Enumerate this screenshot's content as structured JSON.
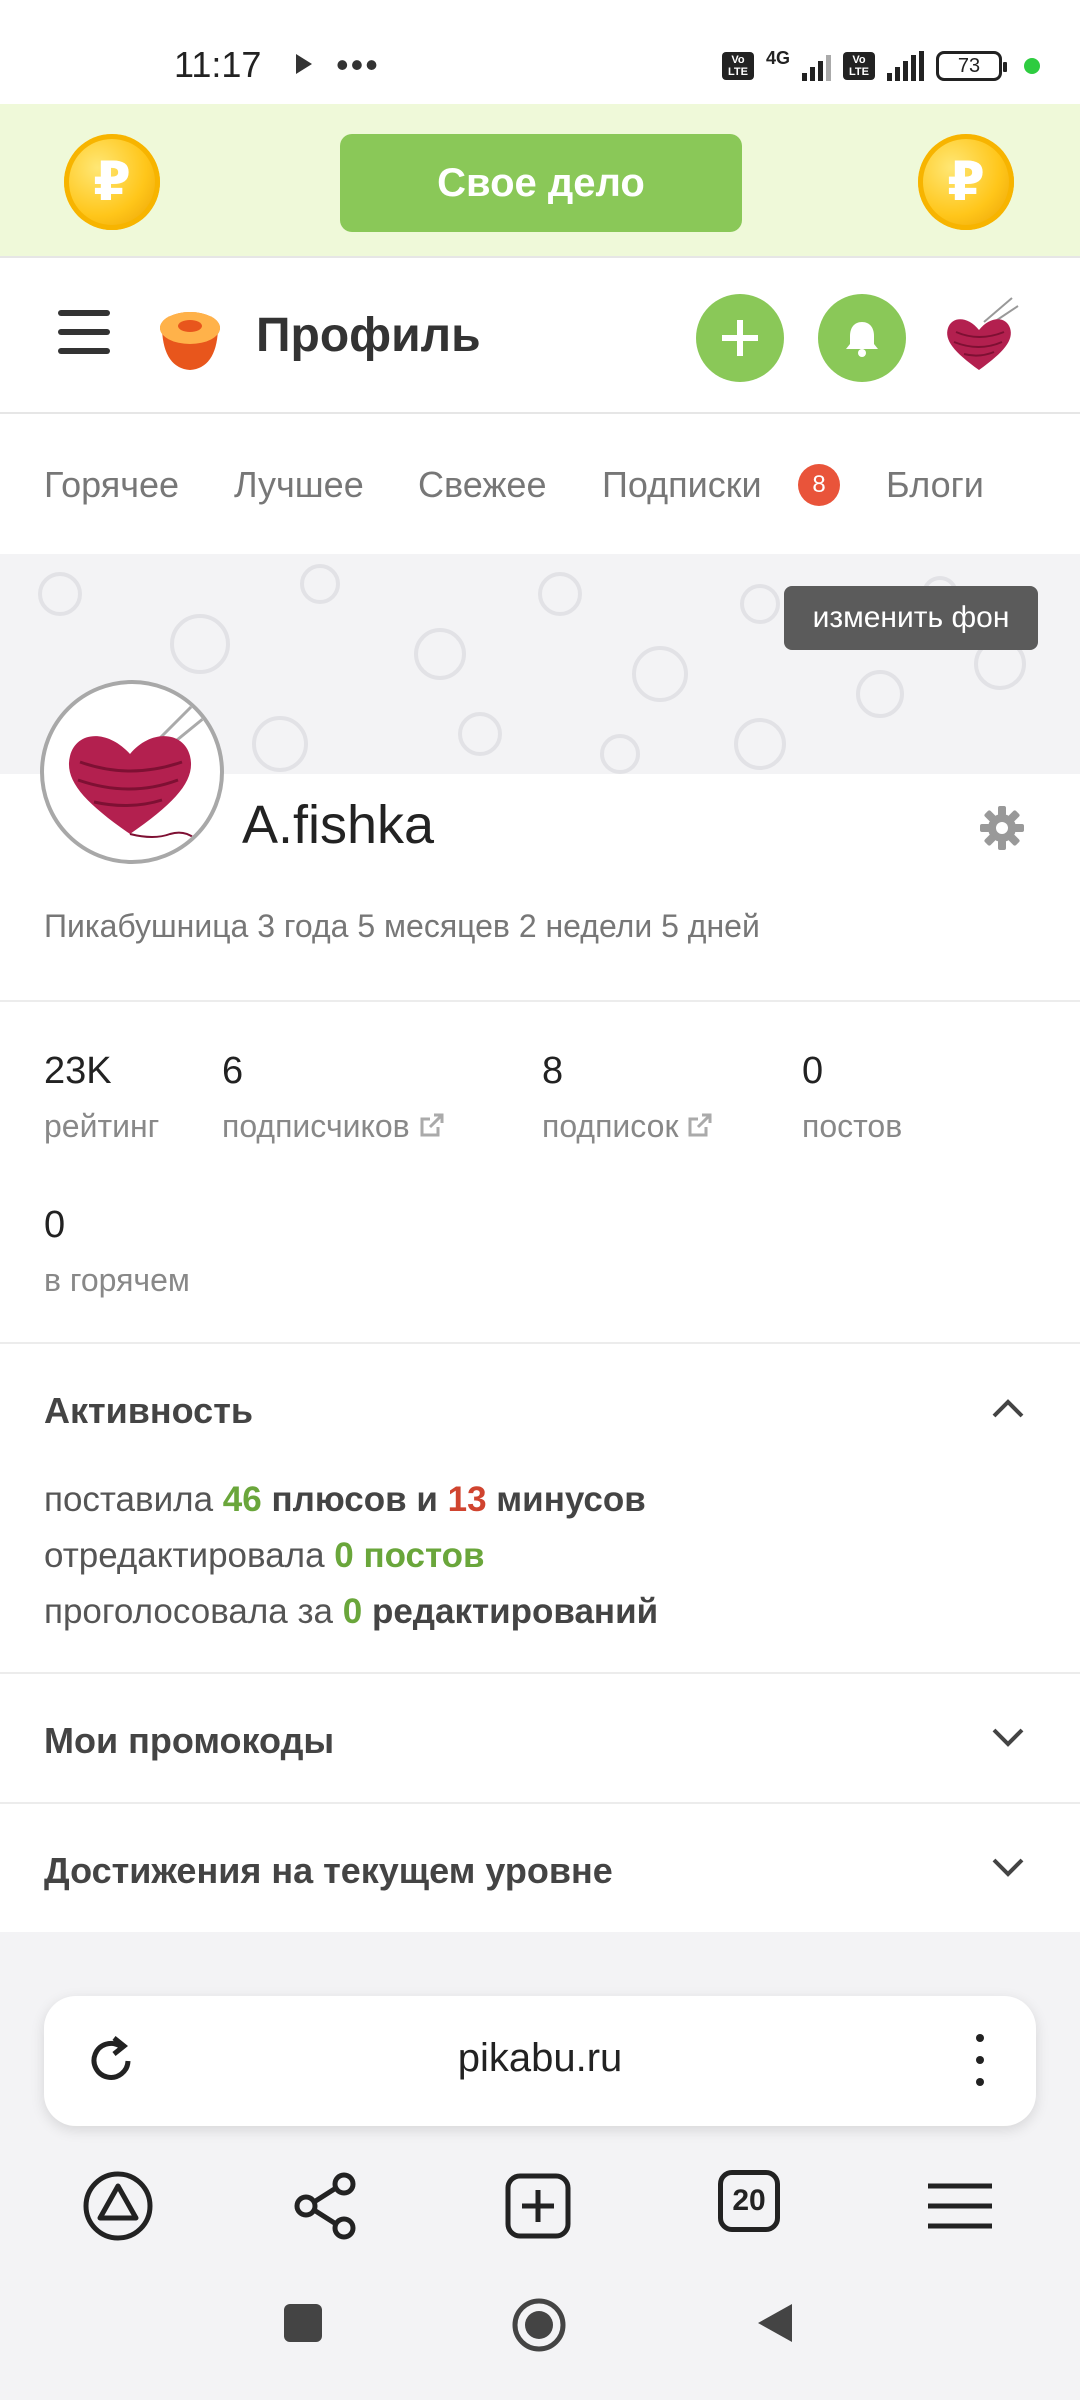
{
  "status_bar": {
    "time": "11:17",
    "dots": "•••",
    "volte": "Vo LTE",
    "network": "4G",
    "battery": "73"
  },
  "promo": {
    "button_label": "Свое дело",
    "coin_symbol": "₽"
  },
  "header": {
    "title": "Профиль",
    "add_icon": "plus-icon",
    "notify_icon": "bell-icon"
  },
  "tabs": [
    {
      "label": "Горячее"
    },
    {
      "label": "Лучшее"
    },
    {
      "label": "Свежее"
    },
    {
      "label": "Подписки",
      "badge": "8"
    },
    {
      "label": "Блоги"
    }
  ],
  "profile": {
    "change_background_label": "изменить фон",
    "username": "A.fishka",
    "member_since": "Пикабушница 3 года 5 месяцев 2 недели 5 дней"
  },
  "stats": [
    {
      "value": "23K",
      "label": "рейтинг"
    },
    {
      "value": "6",
      "label": "подписчиков"
    },
    {
      "value": "8",
      "label": "подписок"
    },
    {
      "value": "0",
      "label": "постов"
    },
    {
      "value": "0",
      "label": "в горячем"
    }
  ],
  "activity": {
    "title": "Активность",
    "line1": {
      "prefix": "поставила",
      "plus": "46",
      "mid": "плюсов и",
      "minus": "13",
      "suffix": "минусов"
    },
    "line2": {
      "prefix": "отредактировала",
      "value": "0 постов"
    },
    "line3": {
      "prefix": "проголосовала за",
      "value": "0",
      "suffix": "редактирований"
    }
  },
  "sections": {
    "promocodes": "Мои промокоды",
    "achievements": "Достижения на текущем уровне"
  },
  "browser": {
    "url": "pikabu.ru",
    "tab_count": "20"
  },
  "colors": {
    "accent_green": "#8ac858",
    "badge_red": "#e9543a",
    "plus_green": "#6aa63b",
    "minus_red": "#d0442f",
    "promo_bg": "#eff9d9"
  }
}
